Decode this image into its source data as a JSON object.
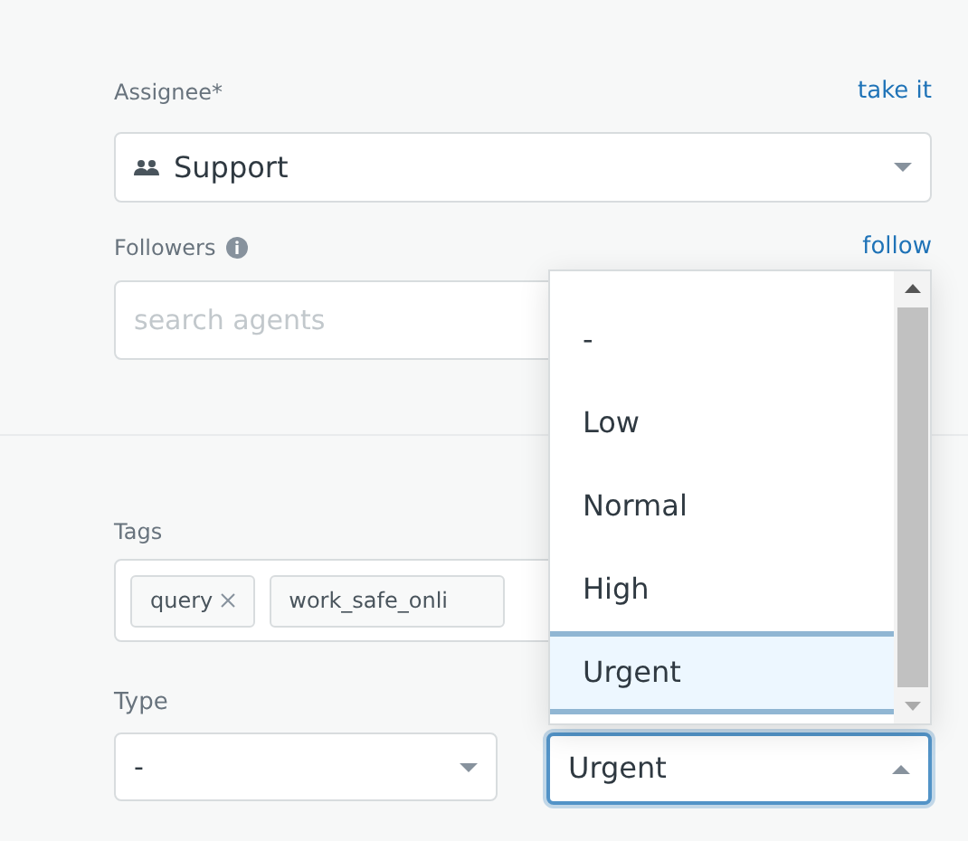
{
  "assignee": {
    "label": "Assignee*",
    "link": "take it",
    "value": "Support"
  },
  "followers": {
    "label": "Followers",
    "link": "follow",
    "placeholder": "search agents"
  },
  "tags": {
    "label": "Tags",
    "items": [
      "query",
      "work_safe_onli"
    ]
  },
  "type": {
    "label": "Type",
    "value": "-"
  },
  "priority": {
    "value": "Urgent",
    "expanded": true,
    "options": [
      {
        "label": "-",
        "selected": false
      },
      {
        "label": "Low",
        "selected": false
      },
      {
        "label": "Normal",
        "selected": false
      },
      {
        "label": "High",
        "selected": false
      },
      {
        "label": "Urgent",
        "selected": true
      }
    ]
  }
}
